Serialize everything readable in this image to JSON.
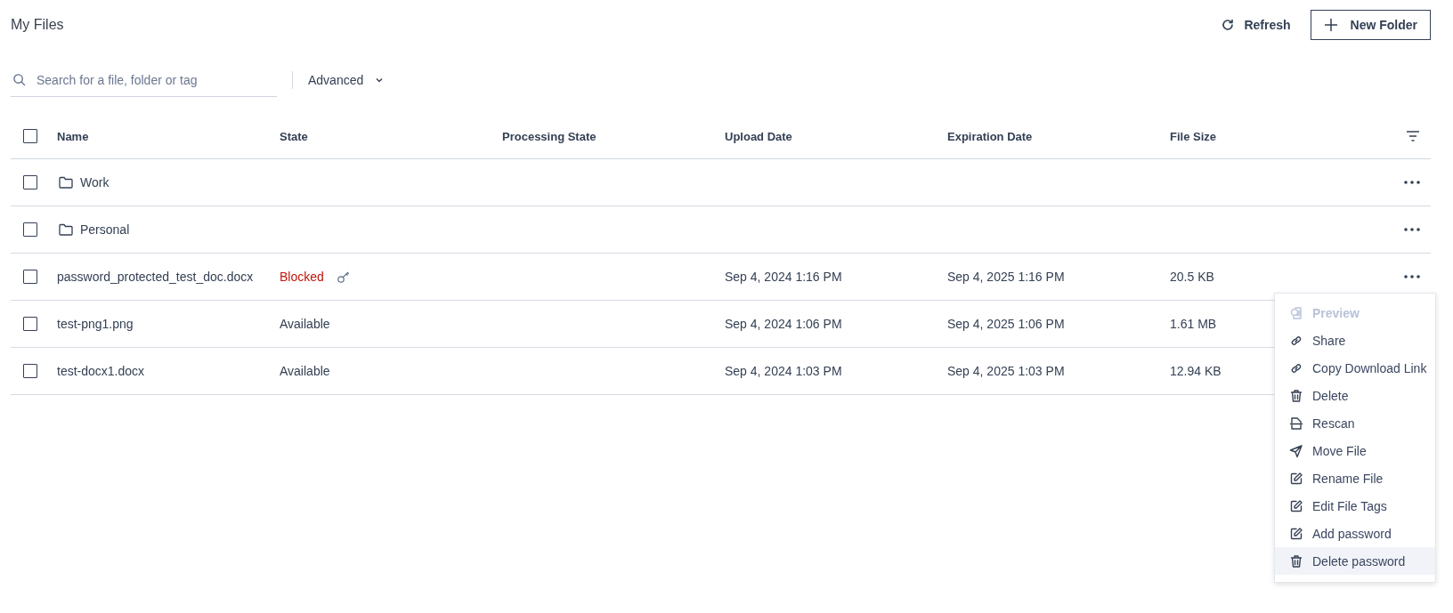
{
  "title": "My Files",
  "actions": {
    "refresh": "Refresh",
    "new_folder": "New Folder"
  },
  "search": {
    "placeholder": "Search for a file, folder or tag"
  },
  "advanced": "Advanced",
  "table": {
    "columns": [
      "Name",
      "State",
      "Processing State",
      "Upload Date",
      "Expiration Date",
      "File Size"
    ],
    "header_checked": false,
    "rows": [
      {
        "kind": "folder",
        "checked": false,
        "name": "Work"
      },
      {
        "kind": "folder",
        "checked": false,
        "name": "Personal"
      },
      {
        "kind": "file",
        "checked": false,
        "name": "password_protected_test_doc.docx",
        "state": "Blocked",
        "blocked": true,
        "upload": "Sep 4, 2024 1:16 PM",
        "expiration": "Sep 4, 2025 1:16 PM",
        "size": "20.5 KB"
      },
      {
        "kind": "file",
        "checked": false,
        "name": "test-png1.png",
        "state": "Available",
        "blocked": false,
        "upload": "Sep 4, 2024 1:06 PM",
        "expiration": "Sep 4, 2025 1:06 PM",
        "size": "1.61 MB"
      },
      {
        "kind": "file",
        "checked": false,
        "name": "test-docx1.docx",
        "state": "Available",
        "blocked": false,
        "upload": "Sep 4, 2024 1:03 PM",
        "expiration": "Sep 4, 2025 1:03 PM",
        "size": "12.94 KB"
      }
    ]
  },
  "menu": {
    "items": [
      {
        "kind": "preview",
        "label": "Preview",
        "disabled": true,
        "selected": false
      },
      {
        "kind": "link",
        "label": "Share",
        "disabled": false,
        "selected": false
      },
      {
        "kind": "link",
        "label": "Copy Download Link",
        "disabled": false,
        "selected": false
      },
      {
        "kind": "trash",
        "label": "Delete",
        "disabled": false,
        "selected": false
      },
      {
        "kind": "rescan",
        "label": "Rescan",
        "disabled": false,
        "selected": false
      },
      {
        "kind": "send",
        "label": "Move File",
        "disabled": false,
        "selected": false
      },
      {
        "kind": "edit",
        "label": "Rename File",
        "disabled": false,
        "selected": false
      },
      {
        "kind": "edit",
        "label": "Edit File Tags",
        "disabled": false,
        "selected": false
      },
      {
        "kind": "edit",
        "label": "Add password",
        "disabled": false,
        "selected": false
      },
      {
        "kind": "trash",
        "label": "Delete password",
        "disabled": false,
        "selected": true
      }
    ]
  }
}
